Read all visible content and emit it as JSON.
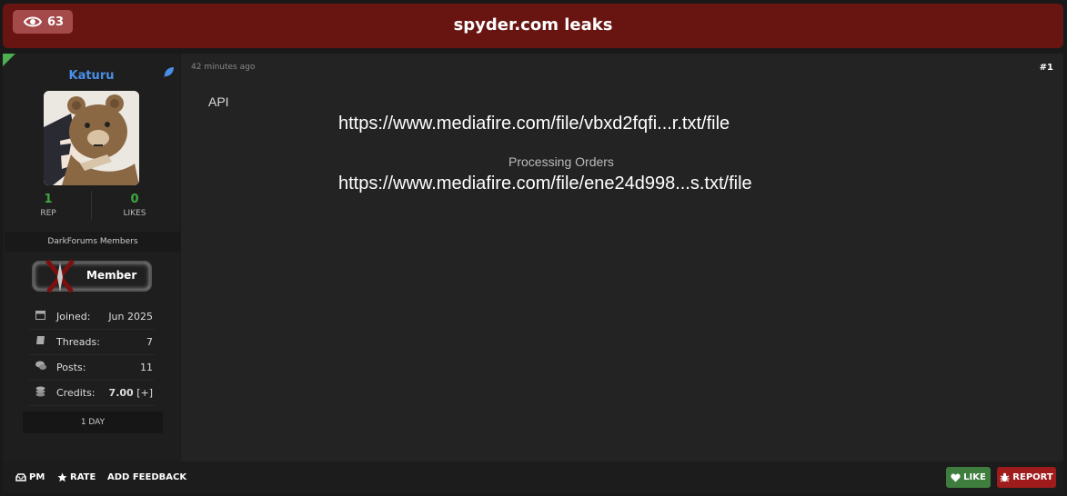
{
  "thread": {
    "title": "spyder.com leaks",
    "views": "63"
  },
  "author": {
    "username": "Katuru",
    "rep_value": "1",
    "rep_label": "REP",
    "likes_value": "0",
    "likes_label": "LIKES",
    "group": "DarkForums Members",
    "rank_badge": "Member",
    "info": [
      {
        "label": "Joined:",
        "value": "Jun 2025",
        "icon": "calendar-icon"
      },
      {
        "label": "Threads:",
        "value": "7",
        "icon": "book-icon"
      },
      {
        "label": "Posts:",
        "value": "11",
        "icon": "comments-icon"
      },
      {
        "label": "Credits:",
        "value": "7.00",
        "extra": "[+]",
        "icon": "coins-icon"
      }
    ],
    "account_age": "1 DAY"
  },
  "post": {
    "time": "42 minutes ago",
    "number": "#1",
    "api_label": "API",
    "link1": "https://www.mediafire.com/file/vbxd2fqfi...r.txt/file",
    "processing_label": "Processing Orders",
    "link2": "https://www.mediafire.com/file/ene24d998...s.txt/file"
  },
  "footer": {
    "pm": "PM",
    "rate": "RATE",
    "feedback": "ADD FEEDBACK",
    "like": "LIKE",
    "report": "REPORT"
  },
  "colors": {
    "title_bar": "#681512",
    "username": "#4a8fe7",
    "stat": "#3ea83e",
    "like": "#3e7d3e",
    "report": "#a01c1c"
  }
}
